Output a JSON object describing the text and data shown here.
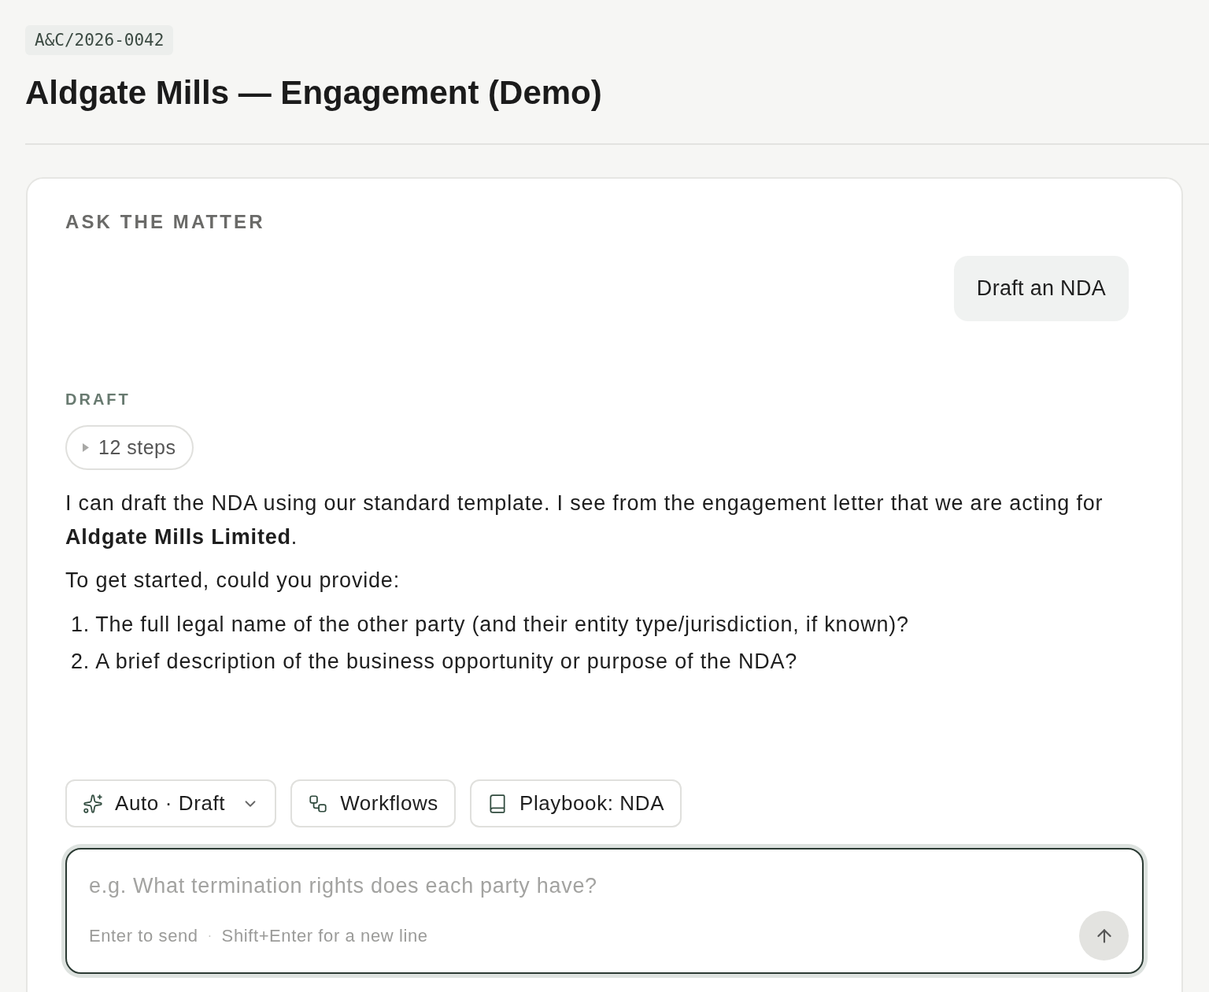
{
  "matter": {
    "reference": "A&C/2026-0042",
    "title": "Aldgate Mills — Engagement (Demo)"
  },
  "panel": {
    "heading": "ASK THE MATTER"
  },
  "messages": [
    {
      "kind": "user",
      "text": "Draft an NDA"
    },
    {
      "kind": "assistant",
      "label": "DRAFT",
      "steps": {
        "label": "12 steps",
        "expanded": false
      },
      "paragraphs": [
        "I can draft the NDA using our standard template. I see from the engagement letter that we are acting for **Aldgate Mills Limited**.",
        "To get started, could you provide:"
      ],
      "list": [
        {
          "number": "1.",
          "text": "The full legal name of the other party (and their entity type/jurisdiction, if known)?"
        },
        {
          "number": "2.",
          "text": "A brief description of the business opportunity or purpose of the NDA?"
        }
      ]
    }
  ],
  "toolbar": [
    {
      "kind": "mode",
      "label": "Auto · Draft",
      "dropdown": true
    },
    {
      "kind": "workflows",
      "label": "Workflows",
      "dropdown": false
    },
    {
      "kind": "playbook",
      "label": "Playbook: NDA",
      "dropdown": false
    }
  ],
  "composer": {
    "placeholder": "e.g. What termination rights does each party have?",
    "hints": [
      "Enter to send",
      "Shift+Enter for a new line"
    ],
    "separator": "·"
  }
}
